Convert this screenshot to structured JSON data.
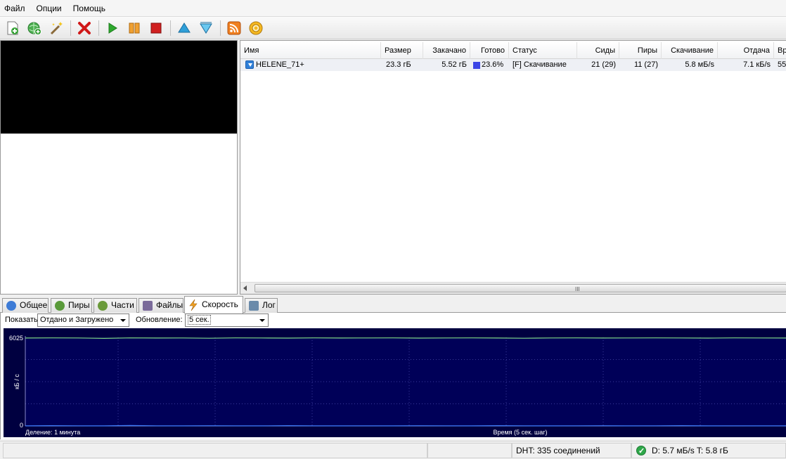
{
  "menu": [
    "Файл",
    "Опции",
    "Помощь"
  ],
  "toolbar": [
    {
      "icon": "add-torrent-icon"
    },
    {
      "icon": "add-url-icon"
    },
    {
      "icon": "create-torrent-icon"
    },
    {
      "icon": "remove-icon"
    },
    {
      "icon": "start-icon"
    },
    {
      "icon": "pause-icon"
    },
    {
      "icon": "stop-icon"
    },
    {
      "icon": "move-up-icon"
    },
    {
      "icon": "move-down-icon"
    },
    {
      "icon": "rss-icon"
    },
    {
      "icon": "settings-icon"
    }
  ],
  "columns": [
    "Имя",
    "Размер",
    "Закачано",
    "Готово",
    "Статус",
    "Сиды",
    "Пиры",
    "Скачивание",
    "Отдача",
    "Вр"
  ],
  "torrents": [
    {
      "name": "HELENE_71+",
      "size": "23.3 гБ",
      "downloaded": "5.52 гБ",
      "done": "23.6%",
      "status": "[F] Скачивание",
      "seeds": "21 (29)",
      "peers": "11 (27)",
      "down_speed": "5.8 мБ/s",
      "up_speed": "7.1 кБ/s",
      "time": "55"
    }
  ],
  "scroll_grip": "III",
  "tabs": [
    {
      "label": "Общее",
      "icon": "info-icon",
      "color": "#3d7bd6"
    },
    {
      "label": "Пиры",
      "icon": "peers-icon",
      "color": "#5a9a3a"
    },
    {
      "label": "Части",
      "icon": "pieces-icon",
      "color": "#6a9a3a"
    },
    {
      "label": "Файлы",
      "icon": "files-icon",
      "color": "#7a6a9a"
    },
    {
      "label": "Скорость",
      "icon": "speed-icon",
      "color": "#f0a020"
    },
    {
      "label": "Лог",
      "icon": "log-icon",
      "color": "#6a8aaa"
    }
  ],
  "speed": {
    "show_label": "Показать:",
    "show_value": "Отдано и Загружено",
    "update_label": "Обновление:",
    "update_value": "5 сек."
  },
  "chart_data": {
    "type": "line",
    "ylabel": "кБ / с",
    "xlabel": "Время (5 сек. шаг)",
    "division_label": "Деление: 1 минута",
    "ylim": [
      0,
      6025
    ],
    "y_ticks": [
      "6025",
      "0"
    ],
    "grid": true,
    "series": [
      {
        "color": "#7fd87f",
        "values": [
          5980,
          5990,
          5985,
          5960,
          5990,
          5980,
          5985,
          5970,
          5990,
          5985,
          5975,
          5990,
          5980,
          5985,
          5990,
          5975,
          5985,
          5990,
          5980,
          5970,
          5985,
          5990,
          5980,
          5985,
          5990,
          5985,
          5975,
          5990,
          5985,
          5980
        ]
      },
      {
        "color": "#4080ff",
        "values": [
          5,
          20,
          10,
          5,
          30,
          10,
          5,
          15,
          10,
          5,
          20,
          10,
          5,
          10,
          5,
          15,
          10,
          5,
          20,
          10,
          5,
          10,
          15,
          5,
          10,
          20,
          5,
          10,
          5,
          10
        ]
      }
    ]
  },
  "status": {
    "dht": "DHT: 335 соединений",
    "speed": "D: 5.7 мБ/s T: 5.8 гБ"
  }
}
